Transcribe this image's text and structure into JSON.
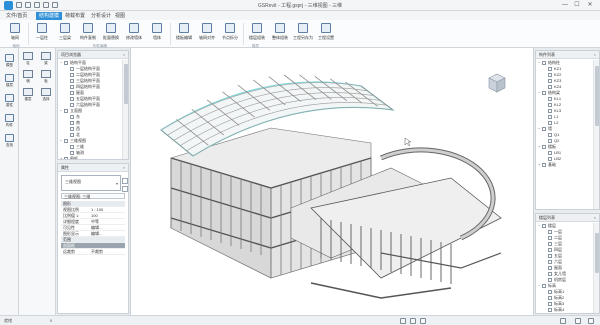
{
  "window": {
    "title": "GSRevit - 工程.gsprj - 三维视图 - 三维",
    "min": "—",
    "max": "☐",
    "close": "✕"
  },
  "tabs": [
    {
      "label": "文件/首页"
    },
    {
      "label": "结构建模"
    },
    {
      "label": "荷载布置"
    },
    {
      "label": "分析设计"
    },
    {
      "label": "视图"
    }
  ],
  "ribbon": {
    "buttons": [
      {
        "label": "轴网"
      },
      {
        "label": "一层柱"
      },
      {
        "label": "三层梁"
      },
      {
        "label": "构件复制"
      },
      {
        "label": "批量替换"
      },
      {
        "label": "修改墙体"
      },
      {
        "label": "墙体"
      },
      {
        "label": "楼板编辑"
      },
      {
        "label": "轴网对齐"
      },
      {
        "label": "节点拆分"
      },
      {
        "label": "楼层组装"
      },
      {
        "label": "整体组装"
      },
      {
        "label": "工程另存为"
      },
      {
        "label": "工程设置"
      }
    ],
    "groups": [
      "轴网",
      "构件编辑",
      "楼层"
    ]
  },
  "leftstrip": {
    "items": [
      {
        "label": "模型"
      },
      {
        "label": "楼层"
      },
      {
        "label": "属性"
      },
      {
        "label": "构件"
      },
      {
        "label": "查找"
      }
    ]
  },
  "toolscol": {
    "items": [
      {
        "label": "柱"
      },
      {
        "label": "梁"
      },
      {
        "label": "墙"
      },
      {
        "label": "板"
      },
      {
        "label": "楼层"
      },
      {
        "label": "选择"
      }
    ]
  },
  "project_browser": {
    "title": "项目浏览器",
    "items": [
      {
        "label": "结构平面",
        "level": 0,
        "expand": "−"
      },
      {
        "label": "一层结构平面",
        "level": 1
      },
      {
        "label": "二层结构平面",
        "level": 1
      },
      {
        "label": "三层结构平面",
        "level": 1
      },
      {
        "label": "四层结构平面",
        "level": 1
      },
      {
        "label": "屋面",
        "level": 1
      },
      {
        "label": "五层结构平面",
        "level": 1
      },
      {
        "label": "六层结构平面",
        "level": 1
      },
      {
        "label": "立面图",
        "level": 0,
        "expand": "−"
      },
      {
        "label": "东",
        "level": 1
      },
      {
        "label": "南",
        "level": 1
      },
      {
        "label": "西",
        "level": 1
      },
      {
        "label": "北",
        "level": 1
      },
      {
        "label": "三维视图",
        "level": 0,
        "expand": "−"
      },
      {
        "label": "三维",
        "level": 1
      },
      {
        "label": "轴测",
        "level": 1
      },
      {
        "label": "图纸",
        "level": 0,
        "expand": "+"
      }
    ]
  },
  "properties": {
    "title": "属性",
    "selector": "三维视图",
    "filter": "三维视图: 三维",
    "rows": [
      {
        "k": "图形",
        "v": "",
        "type": "grp"
      },
      {
        "k": "视图比例",
        "v": "1 : 100"
      },
      {
        "k": "比例值 1:",
        "v": "100"
      },
      {
        "k": "详细程度",
        "v": "中等"
      },
      {
        "k": "可见性",
        "v": "编辑..."
      },
      {
        "k": "图形显示",
        "v": "编辑..."
      },
      {
        "k": "范围",
        "v": "",
        "type": "grp"
      },
      {
        "k": "剖面框",
        "v": "",
        "type": "sel"
      },
      {
        "k": "远裁剪",
        "v": "不裁剪"
      }
    ]
  },
  "right_top": {
    "title": "构件列表",
    "items": [
      {
        "label": "结构柱",
        "level": 0,
        "expand": "−"
      },
      {
        "label": "KZ1",
        "level": 1
      },
      {
        "label": "KZ2",
        "level": 1
      },
      {
        "label": "KZ3",
        "level": 1
      },
      {
        "label": "KZ4",
        "level": 1
      },
      {
        "label": "结构梁",
        "level": 0,
        "expand": "−"
      },
      {
        "label": "KL1",
        "level": 1
      },
      {
        "label": "KL2",
        "level": 1
      },
      {
        "label": "KL3",
        "level": 1
      },
      {
        "label": "L1",
        "level": 1
      },
      {
        "label": "L2",
        "level": 1
      },
      {
        "label": "墙",
        "level": 0,
        "expand": "−"
      },
      {
        "label": "Q1",
        "level": 1
      },
      {
        "label": "Q2",
        "level": 1
      },
      {
        "label": "楼板",
        "level": 0,
        "expand": "+"
      },
      {
        "label": "LB1",
        "level": 1
      },
      {
        "label": "LB2",
        "level": 1
      },
      {
        "label": "基础",
        "level": 0,
        "expand": "+"
      }
    ]
  },
  "right_bottom": {
    "title": "楼层列表",
    "items": [
      {
        "label": "楼层",
        "level": 0,
        "expand": "−"
      },
      {
        "label": "一层",
        "level": 1
      },
      {
        "label": "二层",
        "level": 1
      },
      {
        "label": "三层",
        "level": 1
      },
      {
        "label": "四层",
        "level": 1
      },
      {
        "label": "五层",
        "level": 1
      },
      {
        "label": "六层",
        "level": 1
      },
      {
        "label": "屋面",
        "level": 1
      },
      {
        "label": "女儿墙",
        "level": 1
      },
      {
        "label": "机房层",
        "level": 1
      },
      {
        "label": "标高",
        "level": 0,
        "expand": "−"
      },
      {
        "label": "标高1",
        "level": 1
      },
      {
        "label": "标高2",
        "level": 1
      },
      {
        "label": "标高3",
        "level": 1
      },
      {
        "label": "标高4",
        "level": 1
      }
    ]
  },
  "statusbar": {
    "text": "就绪",
    "coords": "0"
  },
  "colors": {
    "accent": "#2f8fd8",
    "roof_glass": "#7fd6d9",
    "structure": "#c8c8c8"
  }
}
